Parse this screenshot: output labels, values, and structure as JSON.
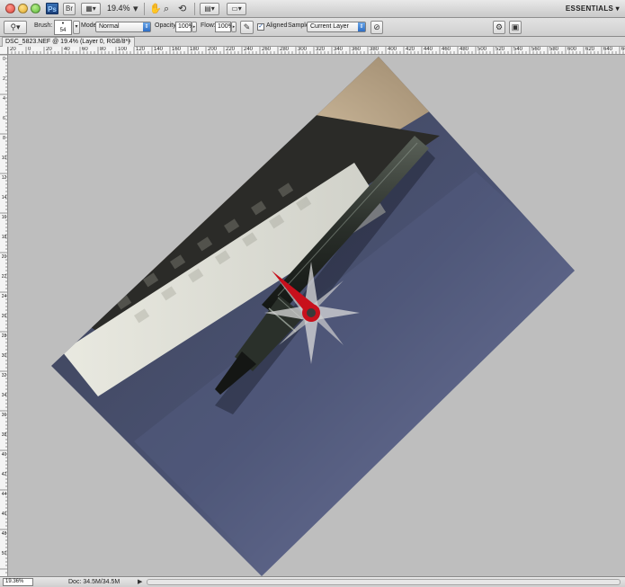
{
  "app": {
    "logo_text": "Ps",
    "zoom_level": "19.4%",
    "workspace_label": "ESSENTIALS ▾"
  },
  "options_bar": {
    "brush_label": "Brush:",
    "brush_size": "54",
    "mode_label": "Mode:",
    "mode_value": "Normal",
    "opacity_label": "Opacity:",
    "opacity_value": "100%",
    "flow_label": "Flow:",
    "flow_value": "100%",
    "aligned_label": "Aligned",
    "aligned_checked": true,
    "sample_label": "Sample:",
    "sample_value": "Current Layer"
  },
  "document_tab": {
    "title": "DSC_5823.NEF @ 19.4% (Layer 0, RGB/8*) *",
    "close_glyph": "×"
  },
  "ruler_top": {
    "labels": [
      "20",
      "0",
      "20",
      "40",
      "60",
      "80",
      "100",
      "120",
      "140",
      "160",
      "180",
      "200",
      "220",
      "240",
      "260",
      "280",
      "300",
      "320",
      "340",
      "360",
      "380",
      "400",
      "420",
      "440",
      "460",
      "480",
      "500",
      "520",
      "540",
      "560",
      "580",
      "600",
      "620",
      "640",
      "660"
    ]
  },
  "ruler_left": {
    "labels": [
      "0",
      "2",
      "4",
      "6",
      "8",
      "10",
      "12",
      "14",
      "16",
      "18",
      "20",
      "22",
      "24",
      "26",
      "28",
      "30",
      "32",
      "34",
      "36",
      "38",
      "40",
      "42",
      "44",
      "46",
      "48",
      "50"
    ]
  },
  "status_bar": {
    "zoom": "19.36%",
    "doc_info": "Doc: 34.5M/34.5M",
    "arrow": "▶"
  },
  "colors": {
    "compass_needle": "#c8101c",
    "canvas_bg": "#bebebe"
  },
  "icons": {
    "tool_preset": "clone-stamp-icon",
    "hand": "hand-icon",
    "zoom": "magnifier-icon",
    "rotate_view": "rotate-view-icon",
    "arrange": "arrange-documents-icon",
    "screen_mode": "screen-mode-icon",
    "airbrush": "airbrush-icon",
    "ignore_adjustment": "ignore-adjustment-layers-icon",
    "clone_source": "clone-source-panel-icon",
    "pressure_opacity": "pressure-icon"
  }
}
